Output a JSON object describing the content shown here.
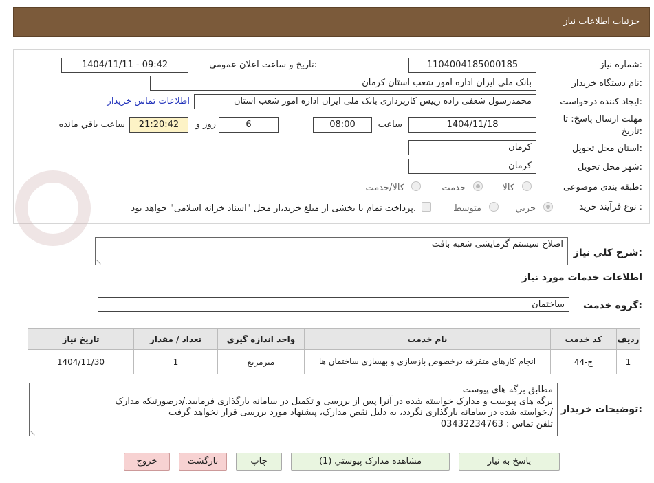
{
  "header": {
    "title": "جزئیات اطلاعات نیاز"
  },
  "fields": {
    "need_number_label": "شماره نیاز:",
    "need_number": "1104004185000185",
    "announce_label": "تاریخ و ساعت اعلان عمومي:",
    "announce_value": "1404/11/11 - 09:42",
    "buyer_label": "نام دستگاه خريدار:",
    "buyer_value": "بانک ملی ایران اداره امور شعب استان کرمان",
    "creator_label": "ایجاد کننده درخواست:",
    "creator_value": "محمدرسول شعفی زاده رییس کارپردازی بانک ملی ایران اداره امور شعب استان",
    "contact_link": "اطلاعات تماس خریدار",
    "deadline_label_1": "مهلت ارسال پاسخ: تا",
    "deadline_label_2": "تاریخ:",
    "deadline_date": "1404/11/18",
    "time_label": "ساعت",
    "deadline_time": "08:00",
    "days_value": "6",
    "days_label": "روز و",
    "remaining_time": "21:20:42",
    "remaining_label": "ساعت باقي مانده",
    "province_label": "استان محل تحویل:",
    "province_value": "کرمان",
    "city_label": "شهر محل تحویل:",
    "city_value": "کرمان",
    "category_label": "طبقه بندی موضوعی:",
    "category_options": [
      "کالا",
      "خدمت",
      "کالا/خدمت"
    ],
    "process_label": "نوع فرآیند خرید :",
    "process_options": [
      "جزیي",
      "متوسط"
    ],
    "payment_note": "پرداخت تمام یا بخشی از مبلغ خرید،از محل \"اسناد خزانه اسلامی\" خواهد بود."
  },
  "summary": {
    "label": "شرح کلي نیاز:",
    "value": "اصلاح سیستم گرمایشی شعبه بافت"
  },
  "services_title": "اطلاعات خدمات مورد نیاز",
  "service_group": {
    "label": "گروه خدمت:",
    "value": "ساختمان"
  },
  "table": {
    "headers": [
      "ردیف",
      "کد خدمت",
      "نام خدمت",
      "واحد اندازه گیری",
      "تعداد / مقدار",
      "تاریخ نیاز"
    ],
    "rows": [
      [
        "1",
        "ج-44",
        "انجام کارهای متفرقه درخصوص بازسازی و بهسازی ساختمان ها",
        "مترمربع",
        "1",
        "1404/11/30"
      ]
    ]
  },
  "buyer_notes": {
    "label": "توضیحات خریدار:",
    "lines": [
      "مطابق برگه های پیوست",
      "برگه های پیوست و مدارک خواسته شده در آنرا پس از بررسی و تکمیل در سامانه بارگذاری فرمایید./درصورتیکه مدارک",
      "خواسته شده در سامانه بارگذاری نگردد، به دلیل نقص مدارک، پیشنهاد مورد بررسی قرار نخواهد گرفت./",
      "تلفن تماس : 03432234763"
    ]
  },
  "buttons": {
    "reply": "پاسخ به نیاز",
    "view_docs": "مشاهده مدارک پیوستي (1)",
    "print": "چاپ",
    "back": "بازگشت",
    "exit": "خروج"
  }
}
